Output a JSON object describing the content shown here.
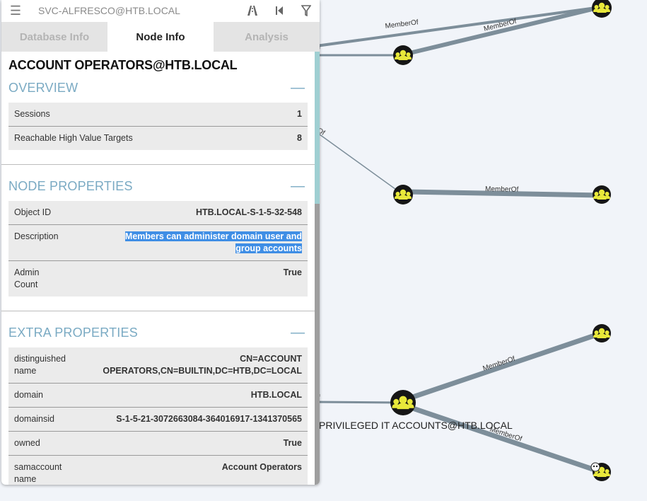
{
  "topbar": {
    "search_value": "SVC-ALFRESCO@HTB.LOCAL"
  },
  "tabs": [
    "Database Info",
    "Node Info",
    "Analysis"
  ],
  "node": {
    "title": "ACCOUNT OPERATORS@HTB.LOCAL"
  },
  "overview": {
    "title": "OVERVIEW",
    "rows": [
      {
        "key": "Sessions",
        "value": "1"
      },
      {
        "key": "Reachable High Value Targets",
        "value": "8"
      }
    ]
  },
  "node_properties": {
    "title": "NODE PROPERTIES",
    "rows": [
      {
        "key": "Object ID",
        "value": "HTB.LOCAL-S-1-5-32-548"
      },
      {
        "key": "Description",
        "value": "Members can administer domain user and group accounts"
      },
      {
        "key": "Admin Count",
        "value": "True"
      }
    ]
  },
  "extra_properties": {
    "title": "EXTRA PROPERTIES",
    "rows": [
      {
        "key": "distinguishedname",
        "value": "CN=ACCOUNT OPERATORS,CN=BUILTIN,DC=HTB,DC=LOCAL"
      },
      {
        "key": "domain",
        "value": "HTB.LOCAL"
      },
      {
        "key": "domainsid",
        "value": "S-1-5-21-3072663084-364016917-1341370565"
      },
      {
        "key": "owned",
        "value": "True"
      },
      {
        "key": "samaccountname",
        "value": "Account Operators"
      }
    ]
  },
  "graph": {
    "edge_label": "MemberOf",
    "node_label": "PRIVILEGED IT ACCOUNTS@HTB.LOCAL",
    "edge_label_fragment_1": "f",
    "edge_label_fragment_2": "Of",
    "edge_label_fragment_3": "f",
    "colors": {
      "edge": "#7d8e9a",
      "node_fill": "#161616",
      "group_icon": "#e8e83a"
    }
  }
}
